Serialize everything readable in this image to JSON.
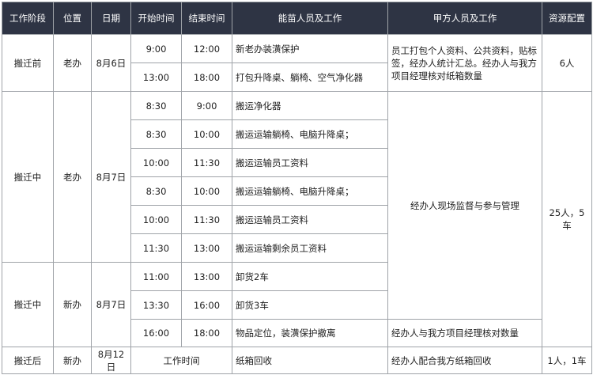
{
  "headers": [
    "工作阶段",
    "位置",
    "日期",
    "开始时间",
    "结束时间",
    "能苗人员及工作",
    "甲方人员及工作",
    "资源配置"
  ],
  "groups": [
    {
      "stage": "搬迁前",
      "location": "老办",
      "date": "8月6日",
      "client_work": "员工打包个人资料、公共资料，贴标签，经办人统计汇总。经办人与我方项目经理核对纸箱数量",
      "resources": "6人",
      "rows": [
        {
          "start": "9:00",
          "end": "12:00",
          "task": "新老办装潢保护"
        },
        {
          "start": "13:00",
          "end": "18:00",
          "task": "打包升降桌、躺椅、空气净化器"
        }
      ]
    },
    {
      "stage": "搬迁中",
      "location": "老办",
      "date": "8月7日",
      "rows": [
        {
          "start": "8:30",
          "end": "9:00",
          "task": "搬运净化器"
        },
        {
          "start": "8:30",
          "end": "10:00",
          "task": "搬运运输躺椅、电脑升降桌；"
        },
        {
          "start": "10:00",
          "end": "11:30",
          "task": "搬运运输员工资料"
        },
        {
          "start": "8:30",
          "end": "10:00",
          "task": "搬运运输躺椅、电脑升降桌；"
        },
        {
          "start": "10:00",
          "end": "11:30",
          "task": "搬运运输员工资料"
        },
        {
          "start": "11:30",
          "end": "13:00",
          "task": "搬运运输剩余员工资料"
        }
      ]
    },
    {
      "stage": "搬迁中",
      "location": "新办",
      "date": "8月7日",
      "rows": [
        {
          "start": "11:00",
          "end": "13:00",
          "task": "卸货2车"
        },
        {
          "start": "13:30",
          "end": "16:00",
          "task": "卸货3车"
        },
        {
          "start": "16:00",
          "end": "18:00",
          "task": "物品定位，装潢保护撤离"
        }
      ]
    },
    {
      "stage": "搬迁后",
      "location": "新办",
      "date": "8月12日",
      "time_label": "工作时间",
      "task": "纸箱回收",
      "client_work": "经办人配合我方纸箱回收",
      "resources": "1人，1车"
    }
  ],
  "moving_client_work": "经办人现场监督与参与管理",
  "moving_resources": "25人，5车",
  "unload_client_work": "经办人与我方项目经理核对数量"
}
